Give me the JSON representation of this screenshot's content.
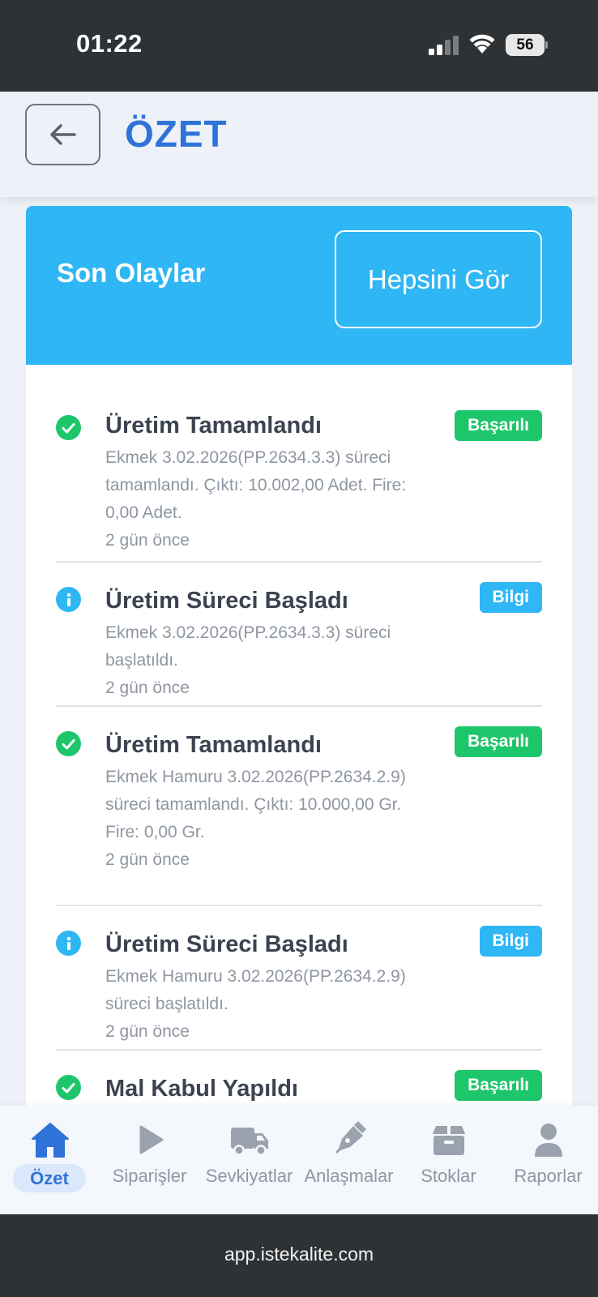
{
  "status_bar": {
    "time": "01:22",
    "battery": "56"
  },
  "header": {
    "title": "ÖZET"
  },
  "recent_events": {
    "title": "Son Olaylar",
    "see_all_label": "Hepsini Gör",
    "items": [
      {
        "status": "success",
        "icon": "check-circle-icon",
        "title": "Üretim Tamamlandı",
        "badge": "Başarılı",
        "description": "Ekmek 3.02.2026(PP.2634.3.3) süreci tamamlandı. Çıktı: 10.002,00 Adet. Fire: 0,00 Adet.",
        "time": "2 gün önce"
      },
      {
        "status": "info",
        "icon": "info-circle-icon",
        "title": "Üretim Süreci Başladı",
        "badge": "Bilgi",
        "description": "Ekmek 3.02.2026(PP.2634.3.3) süreci başlatıldı.",
        "time": "2 gün önce"
      },
      {
        "status": "success",
        "icon": "check-circle-icon",
        "title": "Üretim Tamamlandı",
        "badge": "Başarılı",
        "description": "Ekmek Hamuru 3.02.2026(PP.2634.2.9) süreci tamamlandı. Çıktı: 10.000,00 Gr. Fire: 0,00 Gr.",
        "time": "2 gün önce"
      },
      {
        "status": "info",
        "icon": "info-circle-icon",
        "title": "Üretim Süreci Başladı",
        "badge": "Bilgi",
        "description": "Ekmek Hamuru 3.02.2026(PP.2634.2.9) süreci başlatıldı.",
        "time": "2 gün önce"
      },
      {
        "status": "success",
        "icon": "check-circle-icon",
        "title": "Mal Kabul Yapıldı",
        "badge": "Başarılı",
        "description": "",
        "time": ""
      }
    ]
  },
  "tabs": [
    {
      "label": "Özet",
      "icon": "home-icon",
      "active": true
    },
    {
      "label": "Siparişler",
      "icon": "play-icon",
      "active": false
    },
    {
      "label": "Sevkiyatlar",
      "icon": "truck-icon",
      "active": false
    },
    {
      "label": "Anlaşmalar",
      "icon": "pen-icon",
      "active": false
    },
    {
      "label": "Stoklar",
      "icon": "box-icon",
      "active": false
    },
    {
      "label": "Raporlar",
      "icon": "user-icon",
      "active": false
    }
  ],
  "browser": {
    "url": "app.istekalite.com"
  },
  "colors": {
    "accent": "#2f73d9",
    "header_bar": "#2eb6f5",
    "success": "#1ec66b",
    "info": "#2eb6f5"
  }
}
